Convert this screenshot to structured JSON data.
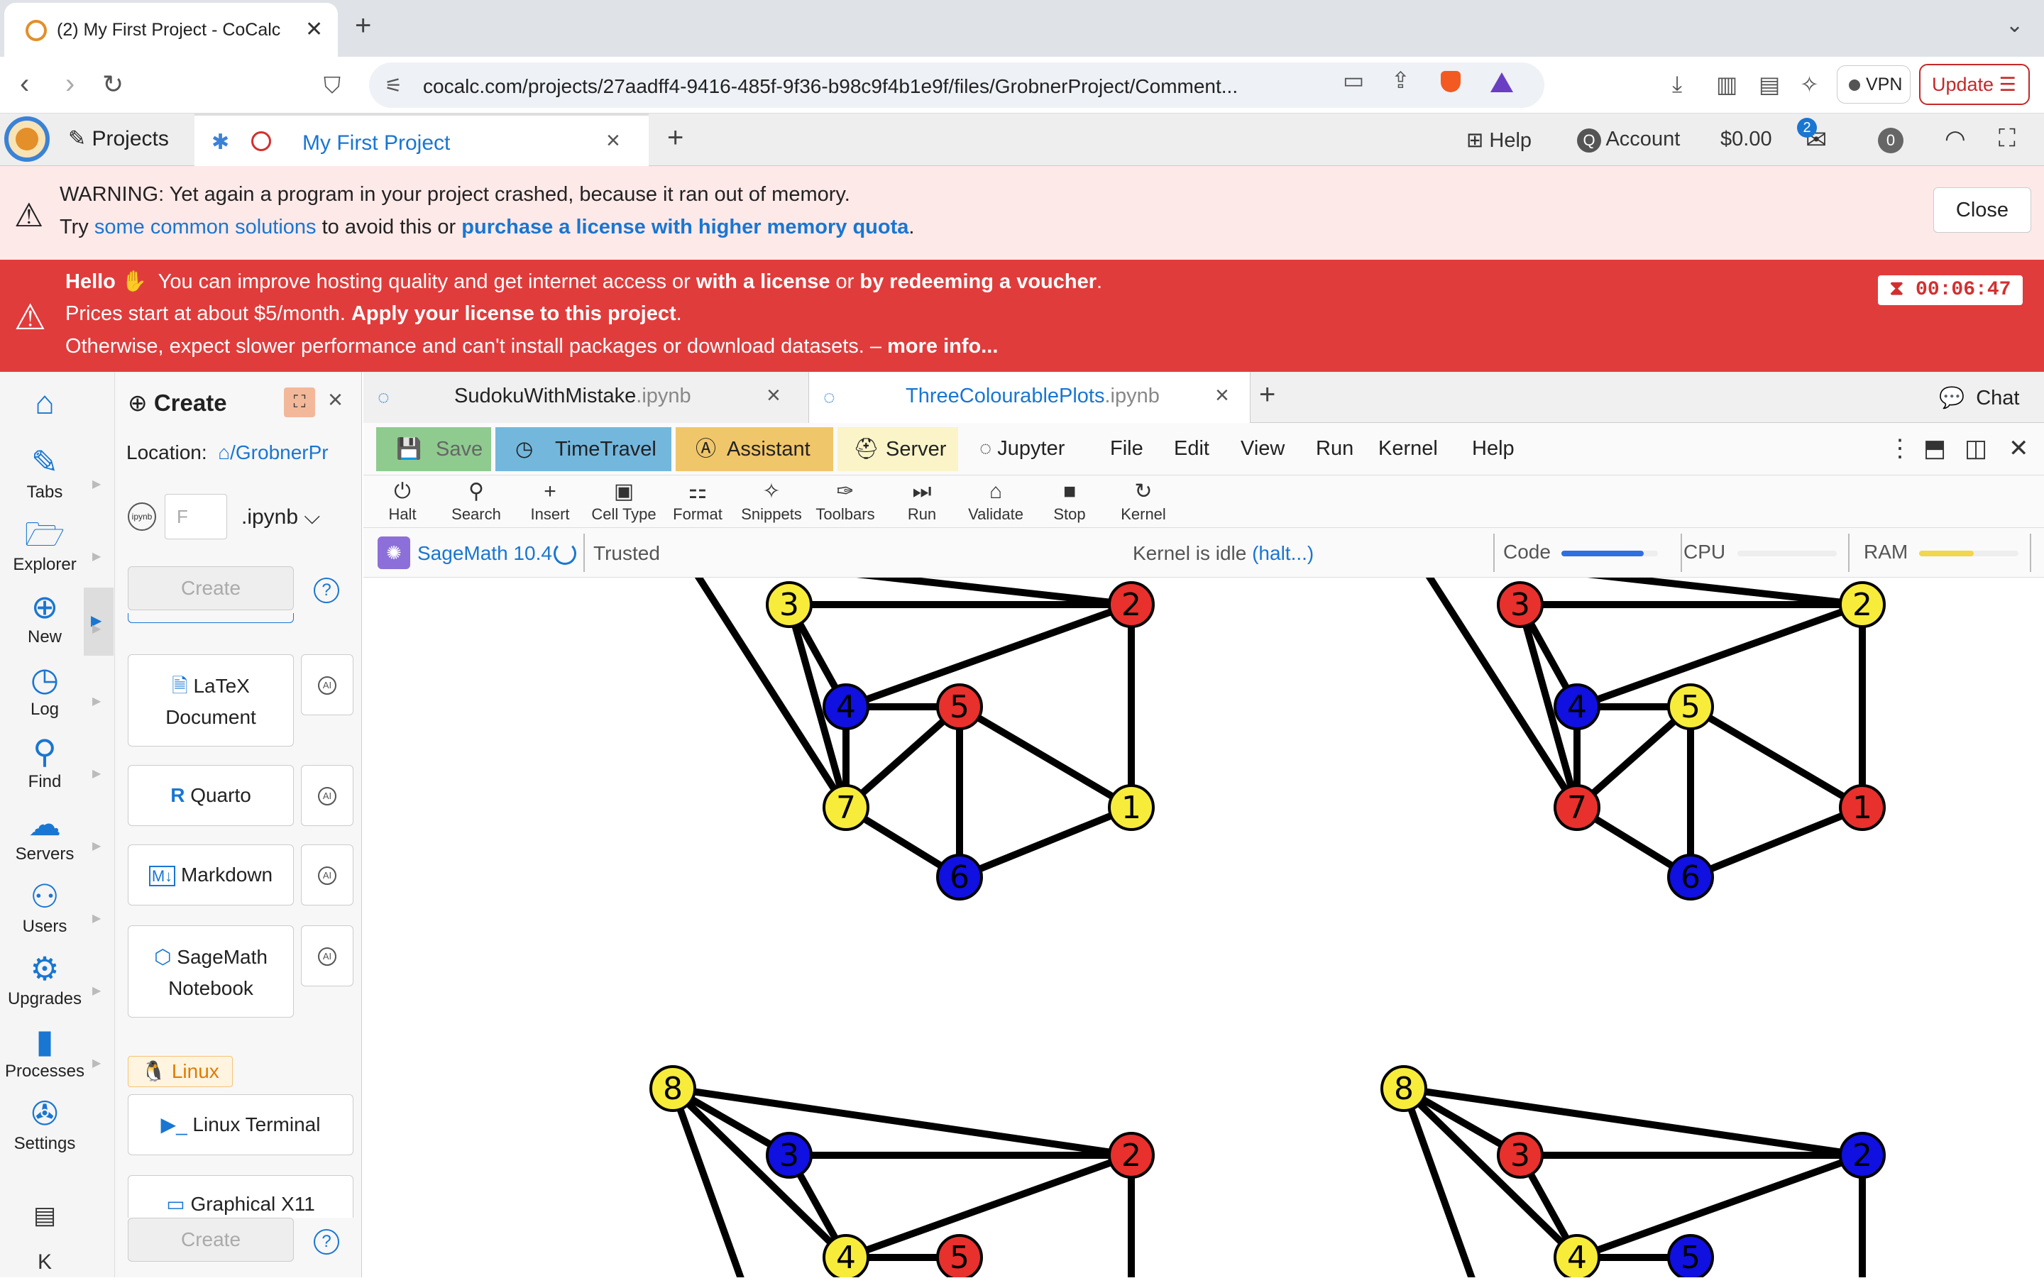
{
  "browser": {
    "tab_title": "(2) My First Project - CoCalc",
    "url": "cocalc.com/projects/27aadff4-9416-485f-9f36-b98c9f4b1e9f/files/GrobnerProject/Comment...",
    "vpn_label": "VPN",
    "update_label": "Update"
  },
  "cocalc_nav": {
    "projects_label": "Projects",
    "project_tab": "My First Project",
    "help_label": "Help",
    "account_label": "Account",
    "balance": "$0.00",
    "notifications_count": "2",
    "zero_badge": "0"
  },
  "warning": {
    "line1": "WARNING: Yet again a program in your project crashed, because it ran out of memory.",
    "line2_pre": "Try ",
    "line2_link1": "some common solutions",
    "line2_mid": " to avoid this or ",
    "line2_link2": "purchase a license with higher memory quota",
    "line2_post": ".",
    "close_label": "Close"
  },
  "hello_banner": {
    "hello": "Hello",
    "line1_a": "You can improve hosting quality and get internet access or ",
    "line1_b": "with a license",
    "line1_c": " or ",
    "line1_d": "by redeeming a voucher",
    "line1_e": ".",
    "line2_a": "Prices start at about $5/month. ",
    "line2_b": "Apply your license to this project",
    "line2_c": ".",
    "line3_a": "Otherwise, expect slower performance and can't install packages or download datasets. – ",
    "line3_b": "more info...",
    "timer": "00:06:47"
  },
  "rail": [
    {
      "label": "Tabs",
      "icon": "✎"
    },
    {
      "label": "Explorer",
      "icon": "🗁"
    },
    {
      "label": "New",
      "icon": "⊕"
    },
    {
      "label": "Log",
      "icon": "◷"
    },
    {
      "label": "Find",
      "icon": "⚲"
    },
    {
      "label": "Servers",
      "icon": "☁"
    },
    {
      "label": "Users",
      "icon": "⚇"
    },
    {
      "label": "Upgrades",
      "icon": "⚙"
    },
    {
      "label": "Processes",
      "icon": "▮"
    },
    {
      "label": "Settings",
      "icon": "✇"
    }
  ],
  "create_panel": {
    "title": "Create",
    "location_label": "Location:",
    "location_path": "/GrobnerPr",
    "filename_placeholder": "F",
    "ext": ".ipynb",
    "create_label": "Create",
    "items": {
      "latex_line1": "LaTeX",
      "latex_line2": "Document",
      "quarto": "Quarto",
      "markdown": "Markdown",
      "sage_line1": "SageMath",
      "sage_line2": "Notebook",
      "linux_tag": "Linux",
      "terminal": "Linux Terminal",
      "x11": "Graphical X11"
    }
  },
  "editor_tabs": [
    {
      "name": "SudokuWithMistake",
      "ext": ".ipynb"
    },
    {
      "name": "ThreeColourablePlots",
      "ext": ".ipynb"
    }
  ],
  "chat_label": "Chat",
  "menubar": {
    "save": "Save",
    "timetravel": "TimeTravel",
    "assistant": "Assistant",
    "server": "Server",
    "jupyter": "Jupyter",
    "file": "File",
    "edit": "Edit",
    "view": "View",
    "run": "Run",
    "kernel": "Kernel",
    "help": "Help"
  },
  "iconbar": [
    {
      "label": "Halt",
      "icon": "⏻"
    },
    {
      "label": "Search",
      "icon": "⚲"
    },
    {
      "label": "Insert",
      "icon": "+"
    },
    {
      "label": "Cell Type",
      "icon": "▣"
    },
    {
      "label": "Format",
      "icon": "⚏"
    },
    {
      "label": "Snippets",
      "icon": "✧"
    },
    {
      "label": "Toolbars",
      "icon": "✑"
    },
    {
      "label": "Run",
      "icon": "⏭"
    },
    {
      "label": "Validate",
      "icon": "⌂"
    },
    {
      "label": "Stop",
      "icon": "■"
    },
    {
      "label": "Kernel",
      "icon": "↻"
    }
  ],
  "status": {
    "kernel_name": "SageMath 10.4",
    "trusted": "Trusted",
    "idle_text": "Kernel is idle ",
    "halt_link": "(halt...)",
    "code_label": "Code",
    "cpu_label": "CPU",
    "ram_label": "RAM",
    "code_level": 0.85,
    "cpu_level": 0.0,
    "ram_level": 0.55
  },
  "colors": {
    "red": "#e8302d",
    "yellow": "#f7ec3a",
    "blue": "#1010e0"
  },
  "graphs": [
    {
      "nodes": [
        {
          "n": "3",
          "c": "yellow"
        },
        {
          "n": "2",
          "c": "red"
        },
        {
          "n": "4",
          "c": "blue"
        },
        {
          "n": "5",
          "c": "red"
        },
        {
          "n": "7",
          "c": "yellow"
        },
        {
          "n": "1",
          "c": "yellow"
        },
        {
          "n": "6",
          "c": "blue"
        }
      ]
    },
    {
      "nodes": [
        {
          "n": "3",
          "c": "red"
        },
        {
          "n": "2",
          "c": "yellow"
        },
        {
          "n": "4",
          "c": "blue"
        },
        {
          "n": "5",
          "c": "yellow"
        },
        {
          "n": "7",
          "c": "red"
        },
        {
          "n": "1",
          "c": "red"
        },
        {
          "n": "6",
          "c": "blue"
        }
      ]
    },
    {
      "nodes": [
        {
          "n": "8",
          "c": "yellow"
        },
        {
          "n": "3",
          "c": "blue"
        },
        {
          "n": "2",
          "c": "red"
        },
        {
          "n": "4",
          "c": "yellow"
        },
        {
          "n": "5",
          "c": "red"
        }
      ]
    },
    {
      "nodes": [
        {
          "n": "8",
          "c": "yellow"
        },
        {
          "n": "3",
          "c": "red"
        },
        {
          "n": "2",
          "c": "blue"
        },
        {
          "n": "4",
          "c": "yellow"
        },
        {
          "n": "5",
          "c": "blue"
        }
      ]
    }
  ]
}
